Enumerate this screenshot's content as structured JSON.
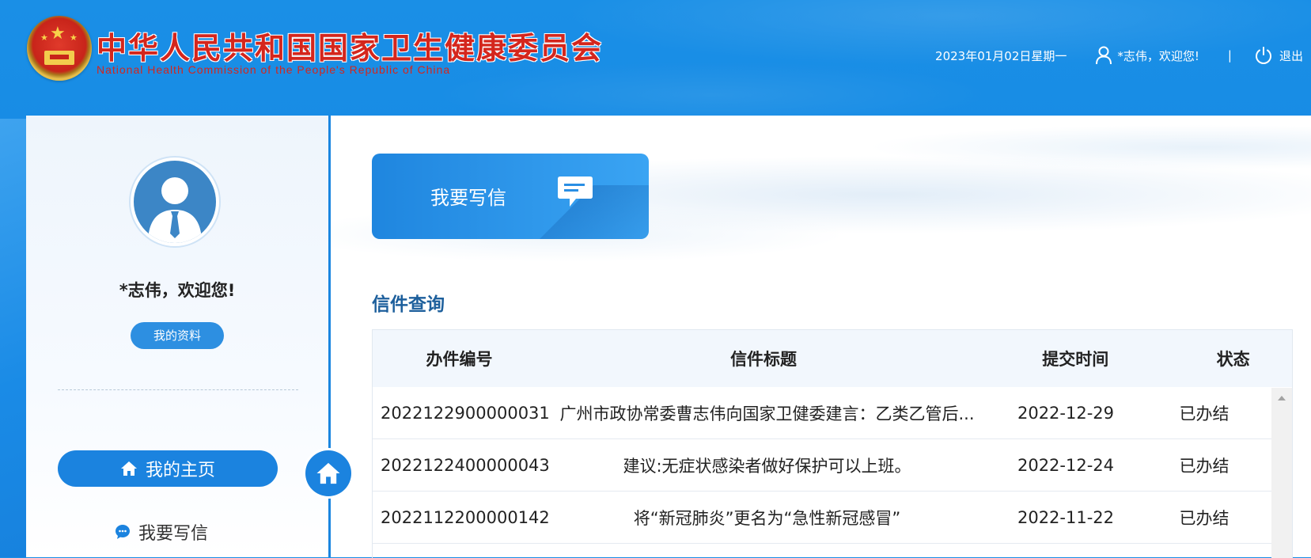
{
  "header": {
    "title_cn": "中华人民共和国国家卫生健康委员会",
    "title_en": "National Health Commission of the People's Republic of China",
    "date": "2023年01月02日星期一",
    "welcome": "*志伟，欢迎您!",
    "separator": "|",
    "logout": "退出"
  },
  "sidebar": {
    "greeting": "*志伟，欢迎您!",
    "profile_button": "我的资料",
    "nav_home": "我的主页",
    "nav_write": "我要写信"
  },
  "main": {
    "write_letter": "我要写信",
    "section_title": "信件查询",
    "table": {
      "headers": [
        "办件编号",
        "信件标题",
        "提交时间",
        "状态"
      ],
      "rows": [
        {
          "id": "2022122900000031",
          "title": "广州市政协常委曹志伟向国家卫健委建言：乙类乙管后...",
          "date": "2022-12-29",
          "status": "已办结"
        },
        {
          "id": "2022122400000043",
          "title": "建议:无症状感染者做好保护可以上班。",
          "date": "2022-12-24",
          "status": "已办结"
        },
        {
          "id": "2022112200000142",
          "title": "将“新冠肺炎”更名为“急性新冠感冒”",
          "date": "2022-11-22",
          "status": "已办结"
        }
      ]
    }
  },
  "colors": {
    "header_bg": "#1a8fe6",
    "accent": "#1b83df",
    "title_red": "#d4261d",
    "section_title": "#1d5f9c"
  }
}
